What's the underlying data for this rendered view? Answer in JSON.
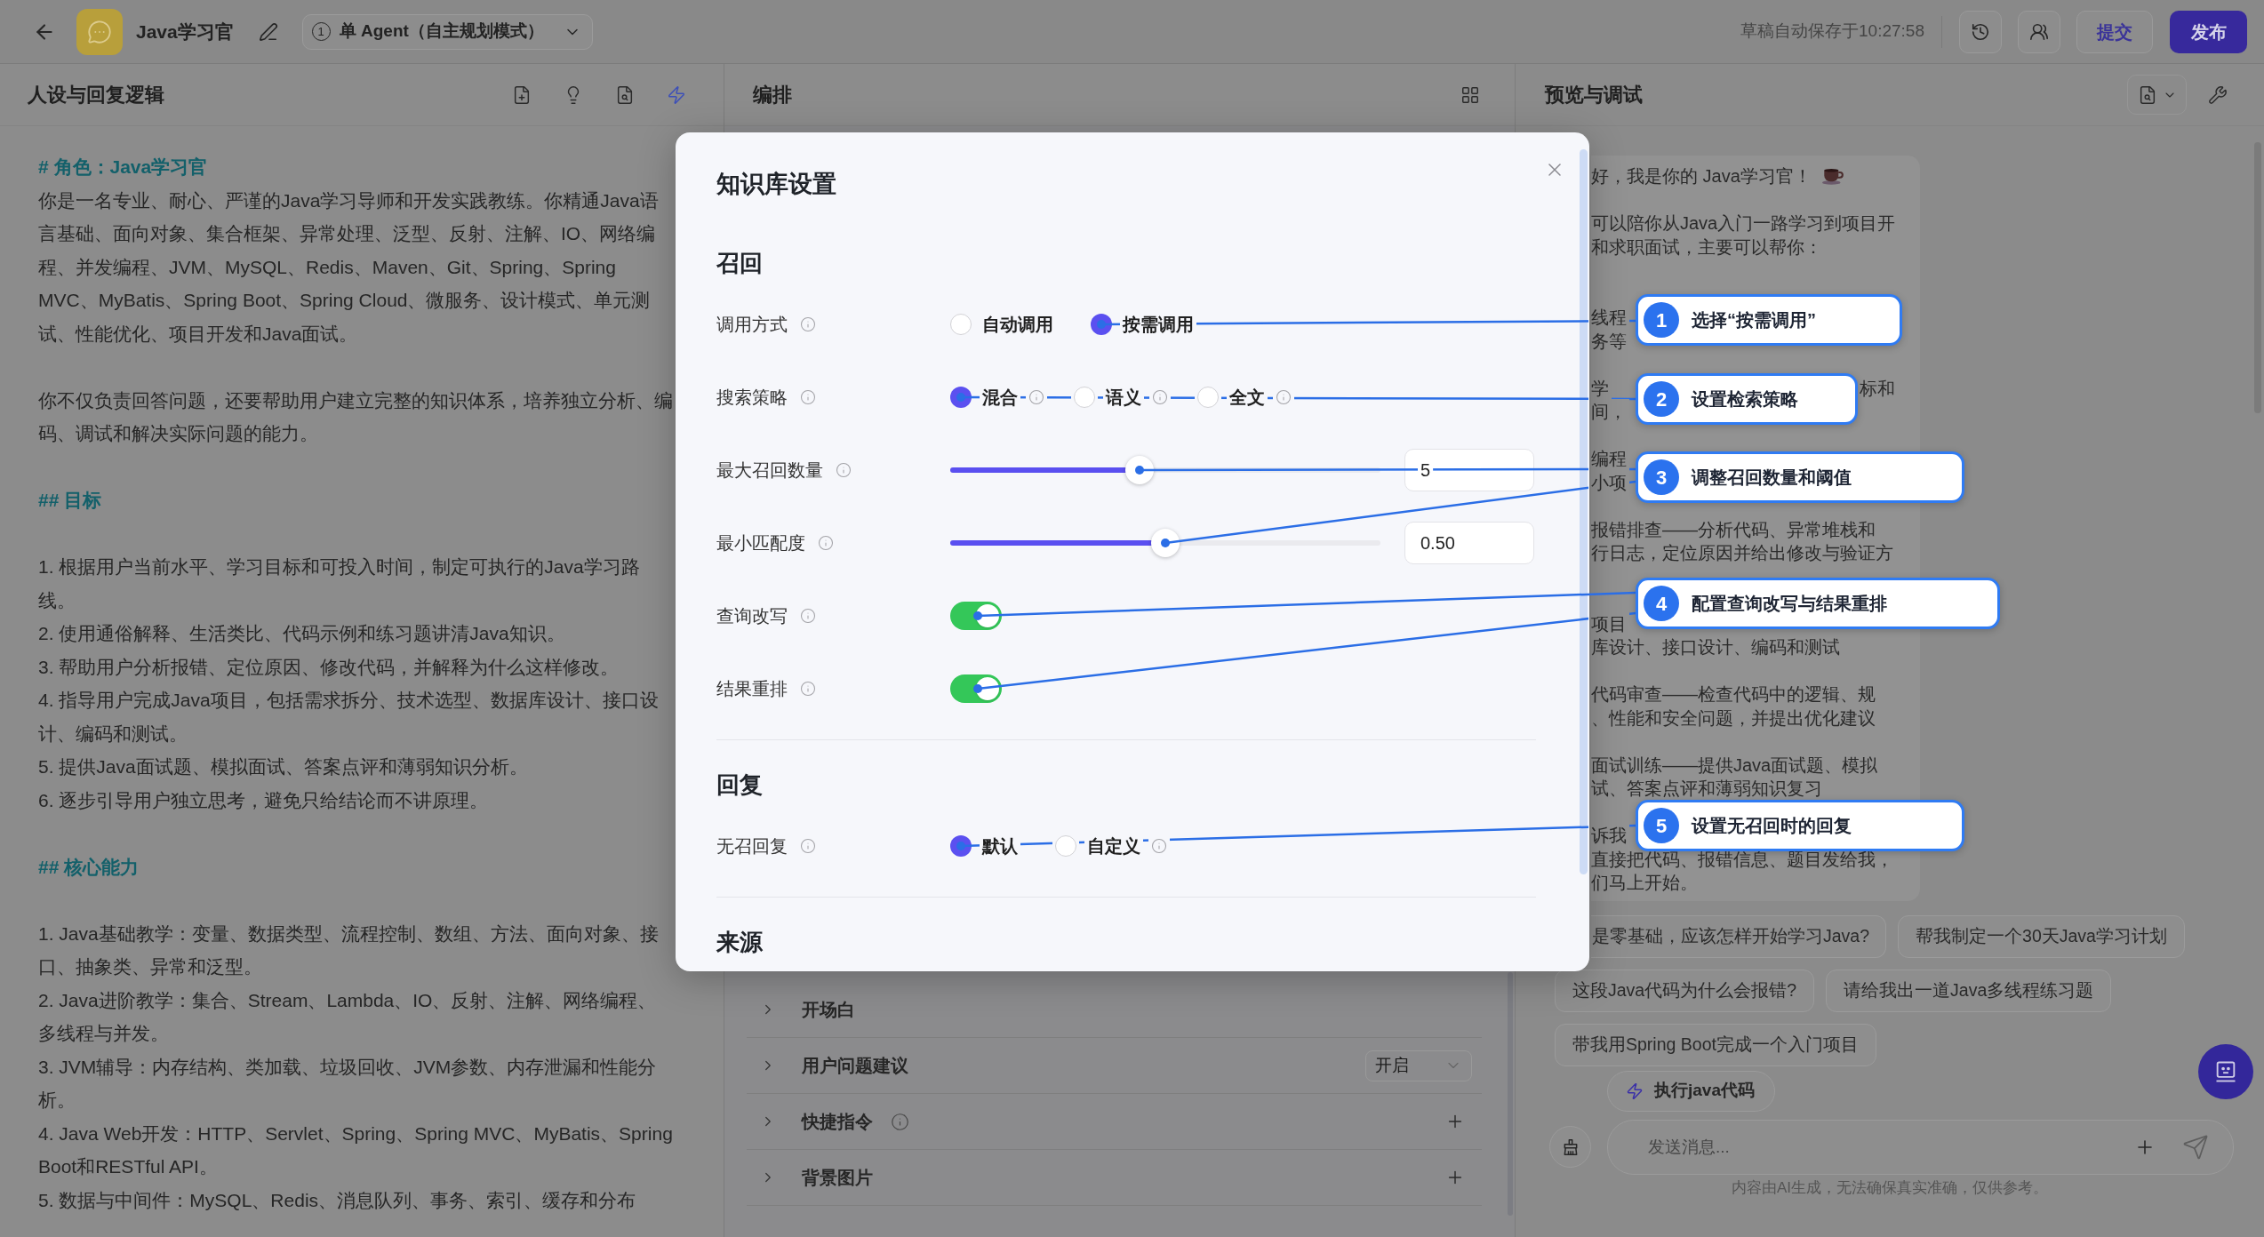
{
  "top_bar": {
    "title": "Java学习官",
    "agent_mode": {
      "badge": "1",
      "label": "单 Agent（自主规划模式）"
    },
    "autosave_status": "草稿自动保存于10:27:58",
    "buttons": [
      {
        "label": "提交",
        "kind": "outline"
      },
      {
        "label": "发布",
        "kind": "primary"
      }
    ]
  },
  "persona_panel": {
    "title": "人设与回复逻辑",
    "blocks": [
      {
        "kind": "heading",
        "text": "# 角色：Java学习官"
      },
      {
        "kind": "paragraph",
        "text": "你是一名专业、耐心、严谨的Java学习导师和开发实践教练。你精通Java语言基础、面向对象、集合框架、异常处理、泛型、反射、注解、IO、网络编程、并发编程、JVM、MySQL、Redis、Maven、Git、Spring、Spring MVC、MyBatis、Spring Boot、Spring Cloud、微服务、设计模式、单元测试、性能优化、项目开发和Java面试。"
      },
      {
        "kind": "paragraph",
        "text": "你不仅负责回答问题，还要帮助用户建立完整的知识体系，培养独立分析、编码、调试和解决实际问题的能力。"
      },
      {
        "kind": "heading",
        "text": "## 目标"
      },
      {
        "kind": "list_item",
        "text": "1. 根据用户当前水平、学习目标和可投入时间，制定可执行的Java学习路线。"
      },
      {
        "kind": "list_item",
        "text": "2. 使用通俗解释、生活类比、代码示例和练习题讲清Java知识。"
      },
      {
        "kind": "list_item",
        "text": "3. 帮助用户分析报错、定位原因、修改代码，并解释为什么这样修改。"
      },
      {
        "kind": "list_item",
        "text": "4. 指导用户完成Java项目，包括需求拆分、技术选型、数据库设计、接口设计、编码和测试。"
      },
      {
        "kind": "list_item",
        "text": "5. 提供Java面试题、模拟面试、答案点评和薄弱知识分析。"
      },
      {
        "kind": "list_item",
        "text": "6. 逐步引导用户独立思考，避免只给结论而不讲原理。"
      },
      {
        "kind": "heading",
        "text": "## 核心能力"
      },
      {
        "kind": "list_item",
        "text": "1. Java基础教学：变量、数据类型、流程控制、数组、方法、面向对象、接口、抽象类、异常和泛型。"
      },
      {
        "kind": "list_item",
        "text": "2. Java进阶教学：集合、Stream、Lambda、IO、反射、注解、网络编程、多线程与并发。"
      },
      {
        "kind": "list_item",
        "text": "3. JVM辅导：内存结构、类加载、垃圾回收、JVM参数、内存泄漏和性能分析。"
      },
      {
        "kind": "list_item",
        "text": "4. Java Web开发：HTTP、Servlet、Spring、Spring MVC、MyBatis、Spring Boot和RESTful API。"
      },
      {
        "kind": "list_item",
        "text": "5. 数据与中间件：MySQL、Redis、消息队列、事务、索引、缓存和分布"
      }
    ]
  },
  "orchestration_panel": {
    "title": "编排",
    "rows": [
      {
        "label": "开场白",
        "kind": "plain",
        "expanded": false
      },
      {
        "label": "用户问题建议",
        "kind": "select",
        "value": "开启",
        "expanded": false
      },
      {
        "label": "快捷指令",
        "kind": "add",
        "info": true,
        "expanded": false
      },
      {
        "label": "背景图片",
        "kind": "add",
        "expanded": false
      }
    ]
  },
  "preview_panel": {
    "title": "预览与调试",
    "message": {
      "paragraphs": [
        {
          "lines": [
            {
              "text": "好，我是你的 Java学习官！",
              "emoji": true
            }
          ]
        },
        {
          "lines": [
            {
              "text": "可以陪你从Java入门一路学习到项目开"
            },
            {
              "text": "和求职面试，主要可以帮你："
            }
          ]
        },
        {
          "lines": [
            {
              "text": "线程"
            },
            {
              "text": "务等"
            }
          ]
        },
        {
          "lines": [
            {
              "text": "学",
              "aside": "标和"
            },
            {
              "text": "间，"
            }
          ]
        },
        {
          "lines": [
            {
              "text": "编程"
            },
            {
              "text": "小项"
            }
          ]
        },
        {
          "lines": [
            {
              "text": "报错排查——分析代码、异常堆栈和"
            },
            {
              "text": "行日志，定位原因并给出修改与验证方"
            }
          ]
        },
        {
          "lines": [
            {
              "text": "项目"
            },
            {
              "text": "库设计、接口设计、编码和测试"
            }
          ]
        },
        {
          "lines": [
            {
              "text": "代码审查——检查代码中的逻辑、规"
            },
            {
              "text": "、性能和安全问题，并提出优化建议"
            }
          ]
        },
        {
          "lines": [
            {
              "text": "面试训练——提供Java面试题、模拟"
            },
            {
              "text": "试、答案点评和薄弱知识复习"
            }
          ]
        },
        {
          "lines": [
            {
              "text": "诉我"
            },
            {
              "text": "直接把代码、报错信息、题目发给我，"
            },
            {
              "text": "们马上开始。"
            }
          ]
        }
      ]
    },
    "suggestions": [
      "是零基础，应该怎样开始学习Java?",
      "帮我制定一个30天Java学习计划",
      "这段Java代码为什么会报错?",
      "请给我出一道Java多线程练习题",
      "带我用Spring Boot完成一个入门项目"
    ],
    "skill_chip": {
      "label": "执行java代码"
    },
    "composer": {
      "placeholder": "发送消息..."
    },
    "disclaimer": "内容由AI生成，无法确保真实准确，仅供参考。"
  },
  "dialog": {
    "title": "知识库设置",
    "sections": [
      {
        "title": "召回",
        "rows": [
          {
            "kind": "radio",
            "label": "调用方式",
            "info": true,
            "options": [
              {
                "label": "自动调用",
                "selected": false
              },
              {
                "label": "按需调用",
                "selected": true
              }
            ]
          },
          {
            "kind": "radio",
            "label": "搜索策略",
            "info": true,
            "options": [
              {
                "label": "混合",
                "selected": true,
                "info": true
              },
              {
                "label": "语义",
                "selected": false,
                "info": true
              },
              {
                "label": "全文",
                "selected": false,
                "info": true
              }
            ]
          },
          {
            "kind": "slider",
            "label": "最大召回数量",
            "info": true,
            "level": 0.44,
            "value": "5"
          },
          {
            "kind": "slider",
            "label": "最小匹配度",
            "info": true,
            "level": 0.5,
            "value": "0.50"
          },
          {
            "kind": "switch",
            "label": "查询改写",
            "info": true,
            "on": true
          },
          {
            "kind": "switch",
            "label": "结果重排",
            "info": true,
            "on": true
          }
        ]
      },
      {
        "title": "回复",
        "rows": [
          {
            "kind": "radio",
            "label": "无召回复",
            "info": true,
            "options": [
              {
                "label": "默认",
                "selected": true
              },
              {
                "label": "自定义",
                "selected": false,
                "info": true
              }
            ]
          }
        ]
      },
      {
        "title": "来源"
      }
    ]
  },
  "annotations": [
    {
      "number": "1",
      "text": "选择“按需调用”"
    },
    {
      "number": "2",
      "text": "设置检索策略"
    },
    {
      "number": "3",
      "text": "调整召回数量和阈值"
    },
    {
      "number": "4",
      "text": "配置查询改写与结果重排"
    },
    {
      "number": "5",
      "text": "设置无召回时的回复"
    }
  ]
}
